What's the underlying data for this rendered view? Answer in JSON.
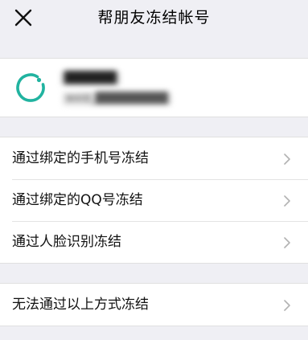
{
  "navbar": {
    "title": "帮朋友冻结帐号",
    "close_icon": "close-icon"
  },
  "account": {
    "avatar_icon": "wechat-loading-ring-icon",
    "name_blurred": "██████",
    "id_blurred": "wxid_█████████",
    "accent_color": "#1aad19"
  },
  "options": [
    {
      "label": "通过绑定的手机号冻结",
      "icon": "chevron-right-icon"
    },
    {
      "label": "通过绑定的QQ号冻结",
      "icon": "chevron-right-icon"
    },
    {
      "label": "通过人脸识别冻结",
      "icon": "chevron-right-icon"
    }
  ],
  "other_option": {
    "label": "无法通过以上方式冻结",
    "icon": "chevron-right-icon"
  }
}
